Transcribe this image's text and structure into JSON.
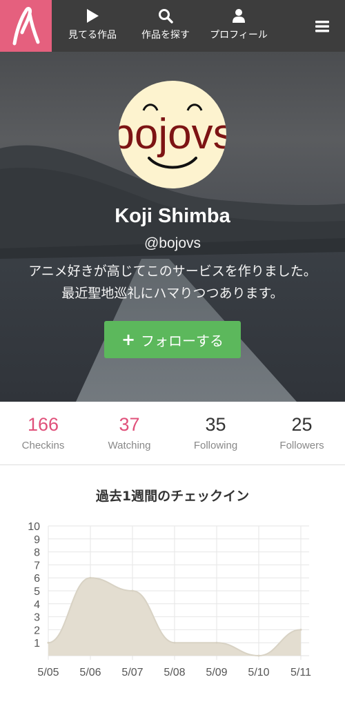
{
  "nav": {
    "items": [
      {
        "label": "見てる作品",
        "icon": "play-icon"
      },
      {
        "label": "作品を探す",
        "icon": "search-icon"
      },
      {
        "label": "プロフィール",
        "icon": "user-icon"
      }
    ],
    "menu_icon": "hamburger-icon",
    "brand_icon": "annict-logo",
    "brand_color": "#e5607e",
    "bar_color": "#3d3d3d"
  },
  "profile": {
    "avatar_text": "bojovs",
    "name": "Koji Shimba",
    "handle": "@bojovs",
    "bio_lines": [
      "アニメ好きが高じてこのサービスを作りました。",
      "最近聖地巡礼にハマりつつあります。"
    ],
    "follow_label": "フォローする",
    "follow_color": "#5cb85c"
  },
  "stats": [
    {
      "value": "166",
      "label": "Checkins"
    },
    {
      "value": "37",
      "label": "Watching"
    },
    {
      "value": "35",
      "label": "Following"
    },
    {
      "value": "25",
      "label": "Followers"
    }
  ],
  "chart_title": "過去1週間のチェックイン",
  "chart_data": {
    "type": "area",
    "title": "過去1週間のチェックイン",
    "xlabel": "",
    "ylabel": "",
    "categories": [
      "5/05",
      "5/06",
      "5/07",
      "5/08",
      "5/09",
      "5/10",
      "5/11"
    ],
    "values": [
      1,
      6,
      5,
      1,
      1,
      0,
      2
    ],
    "ylim": [
      0,
      10
    ],
    "yticks": [
      1,
      2,
      3,
      4,
      5,
      6,
      7,
      8,
      9,
      10
    ],
    "grid": true,
    "fill_color": "#e3ddd0",
    "line_color": "#d8d2c4"
  }
}
